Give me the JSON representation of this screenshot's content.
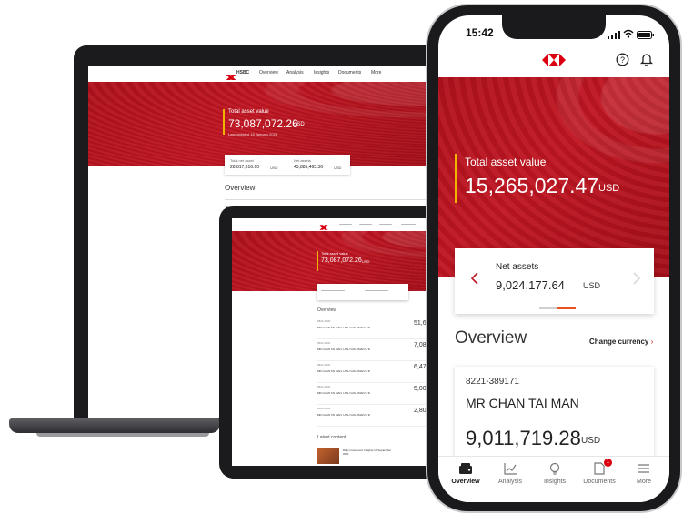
{
  "laptop": {
    "nav_items": [
      "Overview",
      "Analysis",
      "Insights",
      "Documents",
      "More"
    ],
    "hero_label": "Total asset value",
    "hero_value": "73,087,072.26",
    "hero_currency": "USD",
    "hero_updated": "Last updated 18 January 2023",
    "card_left_label": "Total net asset",
    "card_left_value": "28,817,816.90",
    "card_left_currency": "USD",
    "card_right_label": "Net assets",
    "card_right_value": "43,885,465.36",
    "card_right_currency": "USD",
    "overview_title": "Overview"
  },
  "tablet": {
    "hero_label": "Total asset value",
    "hero_value": "73,087,072.26",
    "hero_currency": "USD",
    "overview_title": "Overview",
    "rows": [
      {
        "caption": "0821-0000",
        "name": "MR CHAN TAI MAN, LTAU GOLDMAN LTD",
        "value": "51,62"
      },
      {
        "caption": "0821-0000",
        "name": "MR CHAN TAI MAN, LTAU GOLDMAN LTD",
        "value": "7,087"
      },
      {
        "caption": "0821-0000",
        "name": "MR CHAN TAI MAN, LTAU GOLDMAN LTD",
        "value": "6,472"
      },
      {
        "caption": "0821-0000",
        "name": "MR CHAN TAI MAN, LTAU GOLDMAN LTD",
        "value": "5,005"
      },
      {
        "caption": "0821-0000",
        "name": "MR CHAN TAI MAN, LTAU GOLDMAN LTD",
        "value": "2,802"
      }
    ],
    "latest_title": "Latest content",
    "latest_item": "Daily Investment Insights 14 September 2021"
  },
  "phone": {
    "time": "15:42",
    "hero_label": "Total asset value",
    "hero_value": "15,265,027.47",
    "hero_currency": "USD",
    "net_label": "Net assets",
    "net_value": "9,024,177.64",
    "net_currency": "USD",
    "overview_title": "Overview",
    "change_currency": "Change currency",
    "account_number": "8221-389171",
    "account_name": "MR CHAN TAI MAN",
    "account_value": "9,011,719.28",
    "account_currency": "USD",
    "tabs": [
      {
        "label": "Overview",
        "icon": "wallet-icon"
      },
      {
        "label": "Analysis",
        "icon": "chart-icon"
      },
      {
        "label": "Insights",
        "icon": "lightbulb-icon"
      },
      {
        "label": "Documents",
        "icon": "document-icon"
      },
      {
        "label": "More",
        "icon": "menu-icon"
      }
    ],
    "documents_badge": "1"
  },
  "colors": {
    "brand_red": "#db0011",
    "hero_red": "#b5121d",
    "device_dark": "#1e1e20"
  }
}
